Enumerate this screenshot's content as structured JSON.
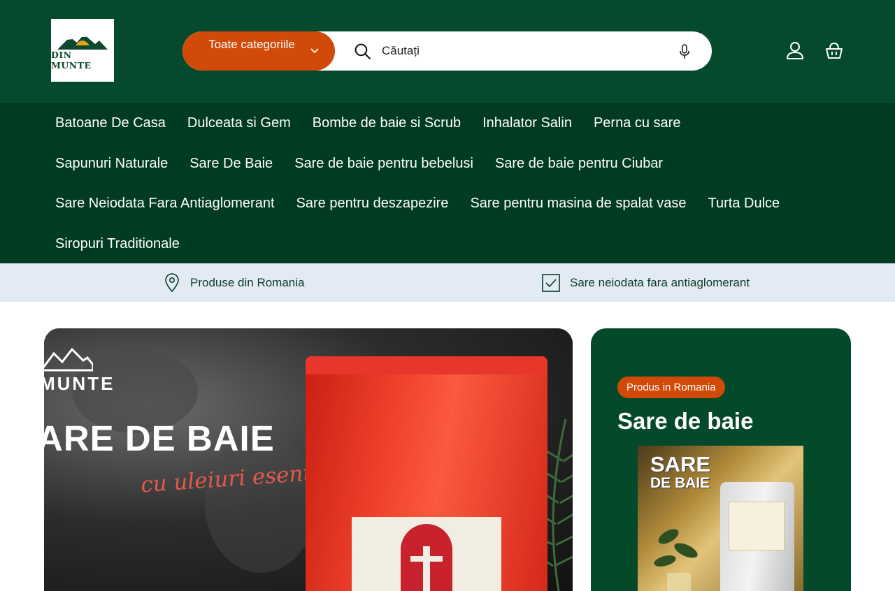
{
  "header": {
    "logo_text": "DIN MUNTE",
    "categories_button": "Toate categoriile",
    "search": {
      "placeholder": "Căutați",
      "value": ""
    }
  },
  "nav": {
    "rows": [
      [
        "Batoane De Casa",
        "Dulceata si Gem",
        "Bombe de baie si Scrub",
        "Inhalator Salin",
        "Perna cu sare"
      ],
      [
        "Sapunuri Naturale",
        "Sare De Baie",
        "Sare de baie pentru bebelusi",
        "Sare de baie pentru Ciubar"
      ],
      [
        "Sare Neiodata Fara Antiaglomerant",
        "Sare pentru deszapezire",
        "Sare pentru masina de spalat vase",
        "Turta Dulce"
      ],
      [
        "Siropuri Traditionale"
      ]
    ]
  },
  "info_bar": {
    "item1": "Produse din Romania",
    "item2": "Sare neiodata fara antiaglomerant"
  },
  "hero": {
    "brand": "MUNTE",
    "title": "ARE DE BAIE",
    "script": "cu uleiuri esentiale"
  },
  "promo": {
    "badge": "Produs in Romania",
    "title": "Sare de baie",
    "image_title": "SARE",
    "image_sub": "DE BAIE"
  },
  "colors": {
    "header_bg": "#054a2c",
    "nav_bg": "#013b22",
    "accent": "#d14a0a",
    "info_bg": "#e2ebf4"
  }
}
